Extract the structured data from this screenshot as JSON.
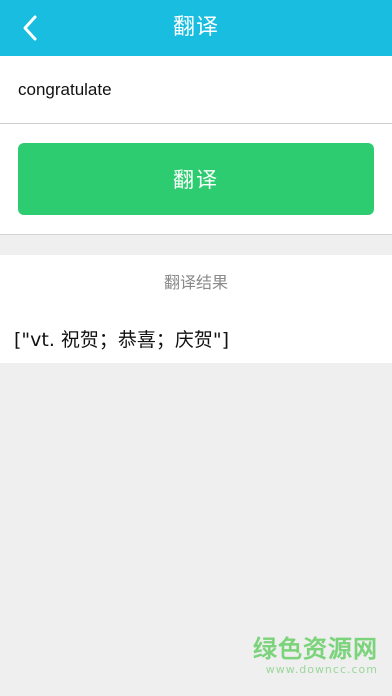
{
  "header": {
    "title": "翻译",
    "back_icon": "chevron-left-icon",
    "background": "#18bde0"
  },
  "input": {
    "value": "congratulate"
  },
  "translate_button": {
    "label": "翻译",
    "color": "#2ecc71"
  },
  "result": {
    "heading": "翻译结果",
    "text": "[\"vt. 祝贺；恭喜；庆贺\"]"
  },
  "watermark": {
    "name": "绿色资源网",
    "url": "www.downcc.com"
  }
}
